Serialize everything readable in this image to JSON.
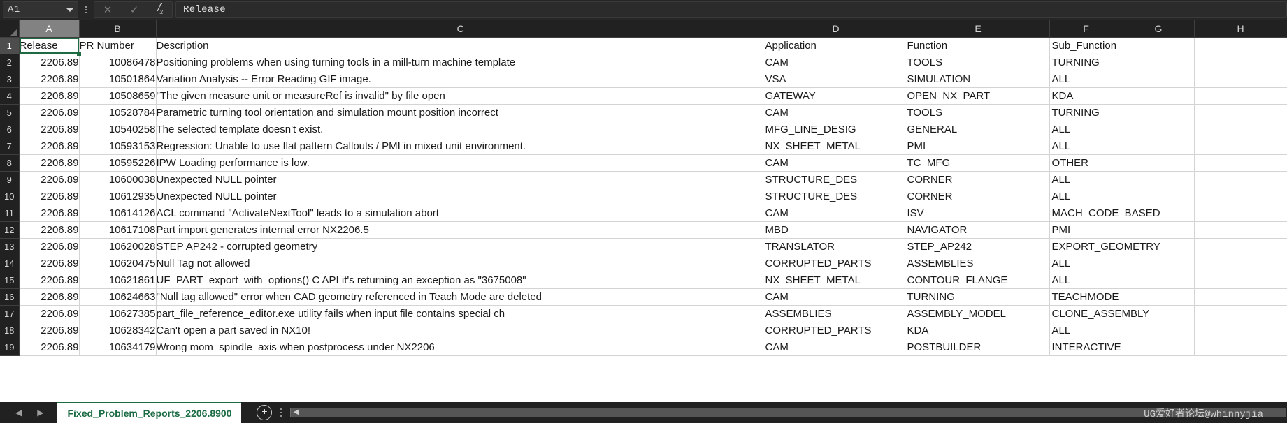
{
  "formula_bar": {
    "name_box_value": "A1",
    "formula_value": "Release",
    "cancel_icon": "close-icon",
    "confirm_icon": "check-icon",
    "function_icon": "fx-icon",
    "menu_icon": "kebab-menu-icon"
  },
  "grid": {
    "column_headers": [
      "A",
      "B",
      "C",
      "D",
      "E",
      "F",
      "G",
      "H"
    ],
    "selected_cell": "A1",
    "selected_column": "A",
    "selected_row": "1",
    "row_numbers": [
      "1",
      "2",
      "3",
      "4",
      "5",
      "6",
      "7",
      "8",
      "9",
      "10",
      "11",
      "12",
      "13",
      "14",
      "15",
      "16",
      "17",
      "18",
      "19"
    ],
    "header_row": {
      "release": "Release",
      "pr_number": "PR Number",
      "description": "Description",
      "application": "Application",
      "function": "Function",
      "sub_function": "Sub_Function",
      "g": "",
      "h": ""
    },
    "rows": [
      {
        "release": "2206.89",
        "pr_number": "10086478",
        "description": "Positioning problems when using turning tools in a mill-turn machine template",
        "application": "CAM",
        "function": "TOOLS",
        "sub_function": "TURNING"
      },
      {
        "release": "2206.89",
        "pr_number": "10501864",
        "description": "Variation Analysis -- Error Reading GIF image.",
        "application": "VSA",
        "function": "SIMULATION",
        "sub_function": "ALL"
      },
      {
        "release": "2206.89",
        "pr_number": "10508659",
        "description": "\"The given measure unit or measureRef is invalid\" by file open",
        "application": "GATEWAY",
        "function": "OPEN_NX_PART",
        "sub_function": "KDA"
      },
      {
        "release": "2206.89",
        "pr_number": "10528784",
        "description": "Parametric turning tool orientation and simulation mount position incorrect",
        "application": "CAM",
        "function": "TOOLS",
        "sub_function": "TURNING"
      },
      {
        "release": "2206.89",
        "pr_number": "10540258",
        "description": "The selected template doesn't exist.",
        "application": "MFG_LINE_DESIG",
        "function": "GENERAL",
        "sub_function": "ALL"
      },
      {
        "release": "2206.89",
        "pr_number": "10593153",
        "description": "Regression: Unable to use flat pattern Callouts / PMI in mixed unit environment.",
        "application": "NX_SHEET_METAL",
        "function": "PMI",
        "sub_function": "ALL"
      },
      {
        "release": "2206.89",
        "pr_number": "10595226",
        "description": "IPW Loading performance is low.",
        "application": "CAM",
        "function": "TC_MFG",
        "sub_function": "OTHER"
      },
      {
        "release": "2206.89",
        "pr_number": "10600038",
        "description": "Unexpected NULL pointer",
        "application": "STRUCTURE_DES",
        "function": "CORNER",
        "sub_function": "ALL"
      },
      {
        "release": "2206.89",
        "pr_number": "10612935",
        "description": "Unexpected NULL pointer",
        "application": "STRUCTURE_DES",
        "function": "CORNER",
        "sub_function": "ALL"
      },
      {
        "release": "2206.89",
        "pr_number": "10614126",
        "description": "ACL command \"ActivateNextTool\" leads to a simulation abort",
        "application": "CAM",
        "function": "ISV",
        "sub_function": "MACH_CODE_BASED"
      },
      {
        "release": "2206.89",
        "pr_number": "10617108",
        "description": "Part import generates internal error NX2206.5",
        "application": "MBD",
        "function": "NAVIGATOR",
        "sub_function": "PMI"
      },
      {
        "release": "2206.89",
        "pr_number": "10620028",
        "description": "STEP AP242 - corrupted geometry",
        "application": "TRANSLATOR",
        "function": "STEP_AP242",
        "sub_function": "EXPORT_GEOMETRY"
      },
      {
        "release": "2206.89",
        "pr_number": "10620475",
        "description": "Null Tag not allowed",
        "application": "CORRUPTED_PARTS",
        "function": "ASSEMBLIES",
        "sub_function": "ALL"
      },
      {
        "release": "2206.89",
        "pr_number": "10621861",
        "description": "UF_PART_export_with_options() C API it's returning an exception as \"3675008\"",
        "application": "NX_SHEET_METAL",
        "function": "CONTOUR_FLANGE",
        "sub_function": "ALL"
      },
      {
        "release": "2206.89",
        "pr_number": "10624663",
        "description": "\"Null tag allowed\" error when CAD geometry referenced in Teach Mode are deleted",
        "application": "CAM",
        "function": "TURNING",
        "sub_function": "TEACHMODE"
      },
      {
        "release": "2206.89",
        "pr_number": "10627385",
        "description": "part_file_reference_editor.exe utility fails when input file contains special ch",
        "application": "ASSEMBLIES",
        "function": "ASSEMBLY_MODEL",
        "sub_function": "CLONE_ASSEMBLY"
      },
      {
        "release": "2206.89",
        "pr_number": "10628342",
        "description": "Can't open a part saved in NX10!",
        "application": "CORRUPTED_PARTS",
        "function": "KDA",
        "sub_function": "ALL"
      },
      {
        "release": "2206.89",
        "pr_number": "10634179",
        "description": "Wrong mom_spindle_axis when postprocess under NX2206",
        "application": "CAM",
        "function": "POSTBUILDER",
        "sub_function": "INTERACTIVE"
      }
    ]
  },
  "bottom_bar": {
    "prev_sheet_icon": "triangle-left-icon",
    "next_sheet_icon": "triangle-right-icon",
    "sheet_tab_label": "Fixed_Problem_Reports_2206.8900",
    "add_sheet_icon": "plus-circle-icon",
    "scroll_menu_icon": "kebab-menu-icon",
    "scroll_left_icon": "triangle-left-icon",
    "watermark": "UG爱好者论坛@whinnyjia"
  },
  "colors": {
    "chrome_dark": "#212121",
    "sheet_tab_accent": "#1b6b43",
    "selection_green": "#1e6b41",
    "grid_line": "#d4d4d4",
    "header_text": "#d5d5d5"
  }
}
